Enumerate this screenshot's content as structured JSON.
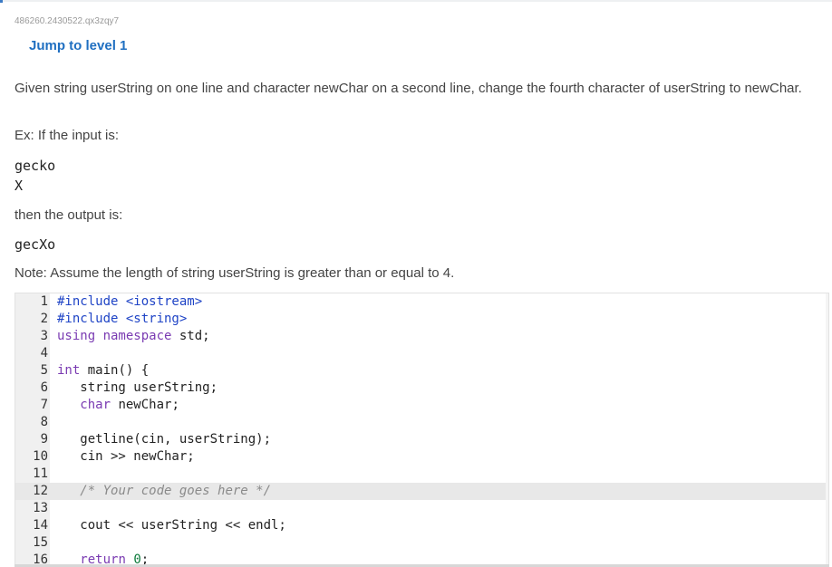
{
  "problem": {
    "id": "486260.2430522.qx3zqy7",
    "jump_label": "Jump to level 1",
    "prompt": "Given string userString on one line and character newChar on a second line, change the fourth character of userString to newChar.",
    "example_intro": "Ex: If the input is:",
    "input_line_1": "gecko",
    "input_line_2": "X",
    "output_intro": "then the output is:",
    "output_line": "gecXo",
    "note": "Note: Assume the length of string userString is greater than or equal to 4."
  },
  "editor": {
    "active_line": 12,
    "lines": [
      {
        "n": "1",
        "parts": [
          {
            "t": "#include <iostream>",
            "c": "pp"
          }
        ]
      },
      {
        "n": "2",
        "parts": [
          {
            "t": "#include <string>",
            "c": "pp"
          }
        ]
      },
      {
        "n": "3",
        "parts": [
          {
            "t": "using namespace",
            "c": "kw"
          },
          {
            "t": " std;",
            "c": ""
          }
        ]
      },
      {
        "n": "4",
        "parts": []
      },
      {
        "n": "5",
        "parts": [
          {
            "t": "int",
            "c": "kw"
          },
          {
            "t": " main() {",
            "c": ""
          }
        ]
      },
      {
        "n": "6",
        "parts": [
          {
            "t": "   string userString;",
            "c": ""
          }
        ]
      },
      {
        "n": "7",
        "parts": [
          {
            "t": "   ",
            "c": ""
          },
          {
            "t": "char",
            "c": "kw"
          },
          {
            "t": " newChar;",
            "c": ""
          }
        ]
      },
      {
        "n": "8",
        "parts": []
      },
      {
        "n": "9",
        "parts": [
          {
            "t": "   getline(cin, userString);",
            "c": ""
          }
        ]
      },
      {
        "n": "10",
        "parts": [
          {
            "t": "   cin >> newChar;",
            "c": ""
          }
        ]
      },
      {
        "n": "11",
        "parts": []
      },
      {
        "n": "12",
        "parts": [
          {
            "t": "   ",
            "c": ""
          },
          {
            "t": "/* Your code goes here */",
            "c": "comment"
          }
        ]
      },
      {
        "n": "13",
        "parts": []
      },
      {
        "n": "14",
        "parts": [
          {
            "t": "   cout << userString << endl;",
            "c": ""
          }
        ]
      },
      {
        "n": "15",
        "parts": []
      },
      {
        "n": "16",
        "parts": [
          {
            "t": "   ",
            "c": ""
          },
          {
            "t": "return",
            "c": "kw"
          },
          {
            "t": " ",
            "c": ""
          },
          {
            "t": "0",
            "c": "num"
          },
          {
            "t": ";",
            "c": ""
          }
        ]
      }
    ]
  },
  "colors": {
    "link": "#1f6fc1",
    "gutter": "#f0f0f0",
    "active_line": "#e8e8e8"
  }
}
